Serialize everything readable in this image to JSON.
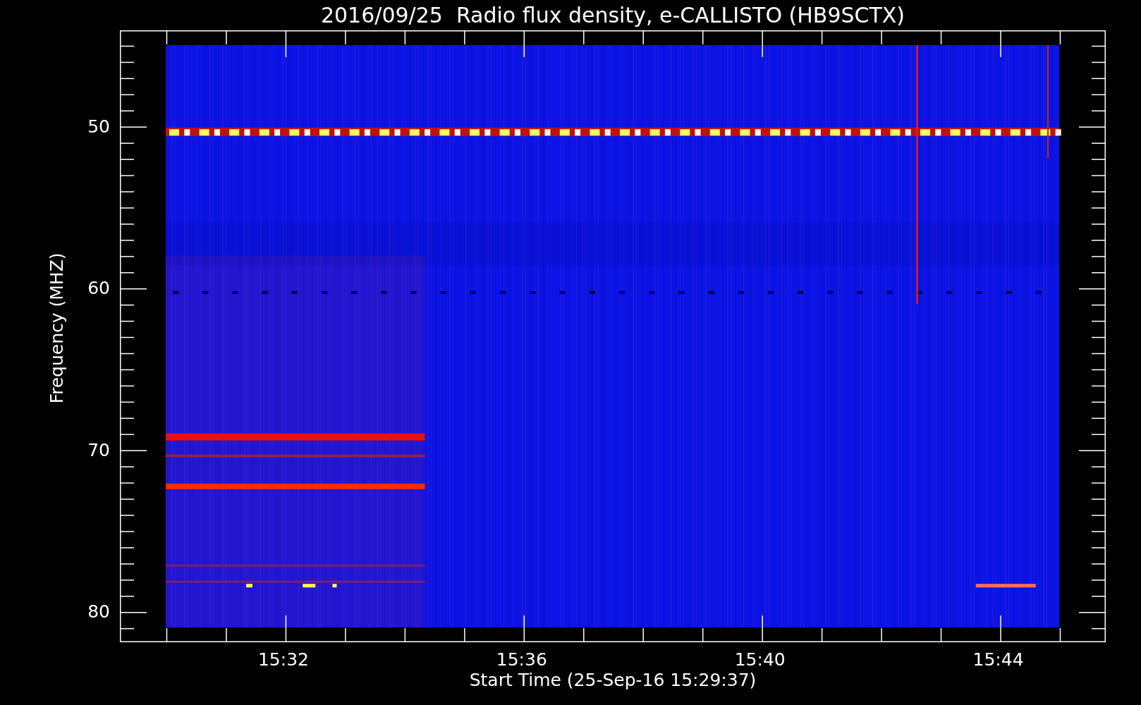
{
  "title": "2016/09/25  Radio flux density, e-CALLISTO (HB9SCTX)",
  "y_axis": {
    "label": "Frequency (MHZ)",
    "ticks": [
      "50",
      "60",
      "70",
      "80"
    ]
  },
  "x_axis": {
    "label": "Start Time (25-Sep-16 15:29:37)",
    "ticks": [
      "15:32",
      "15:36",
      "15:40",
      "15:44"
    ]
  }
}
